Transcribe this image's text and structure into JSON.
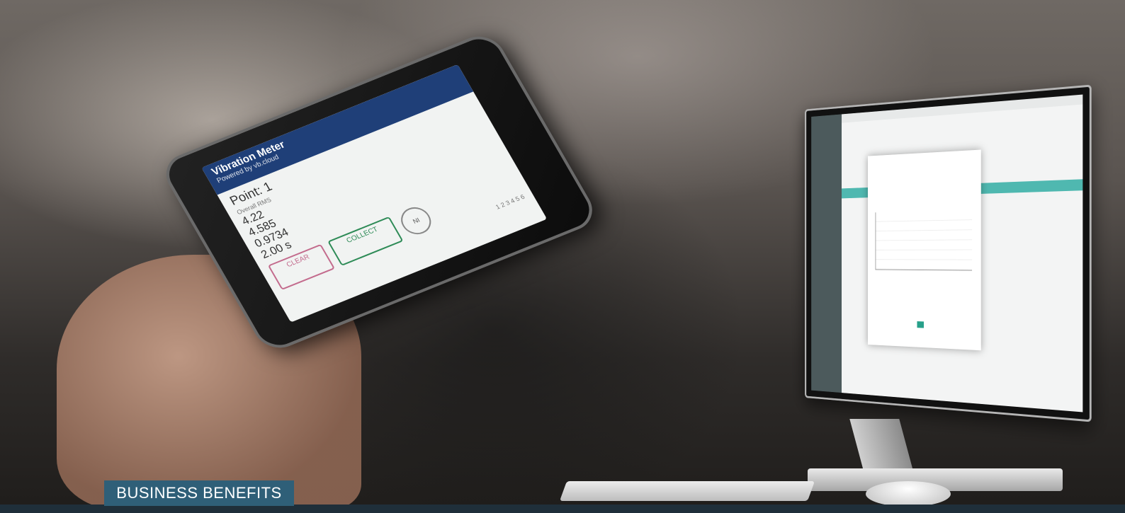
{
  "photo": {
    "description_icon": "tablet-and-monitor-photo",
    "phone": {
      "app_title": "Vibration Meter",
      "app_subtitle": "Powered by vb.cloud",
      "point_title": "Point: 1",
      "rows": [
        {
          "label": "Overall RMS",
          "value": "4.22"
        },
        {
          "label": "",
          "value": "4.585"
        },
        {
          "label": "",
          "value": "0.9734"
        },
        {
          "label": "",
          "value": "2.00 s"
        }
      ],
      "clear_label": "CLEAR",
      "collect_label": "COLLECT",
      "ni_label": "NI",
      "pages": "1 2 3 4 5 6"
    }
  },
  "banner": {
    "label": "BUSINESS BENEFITS",
    "label_bg": "#2f5f78",
    "band_color": "#1f2f3a"
  }
}
